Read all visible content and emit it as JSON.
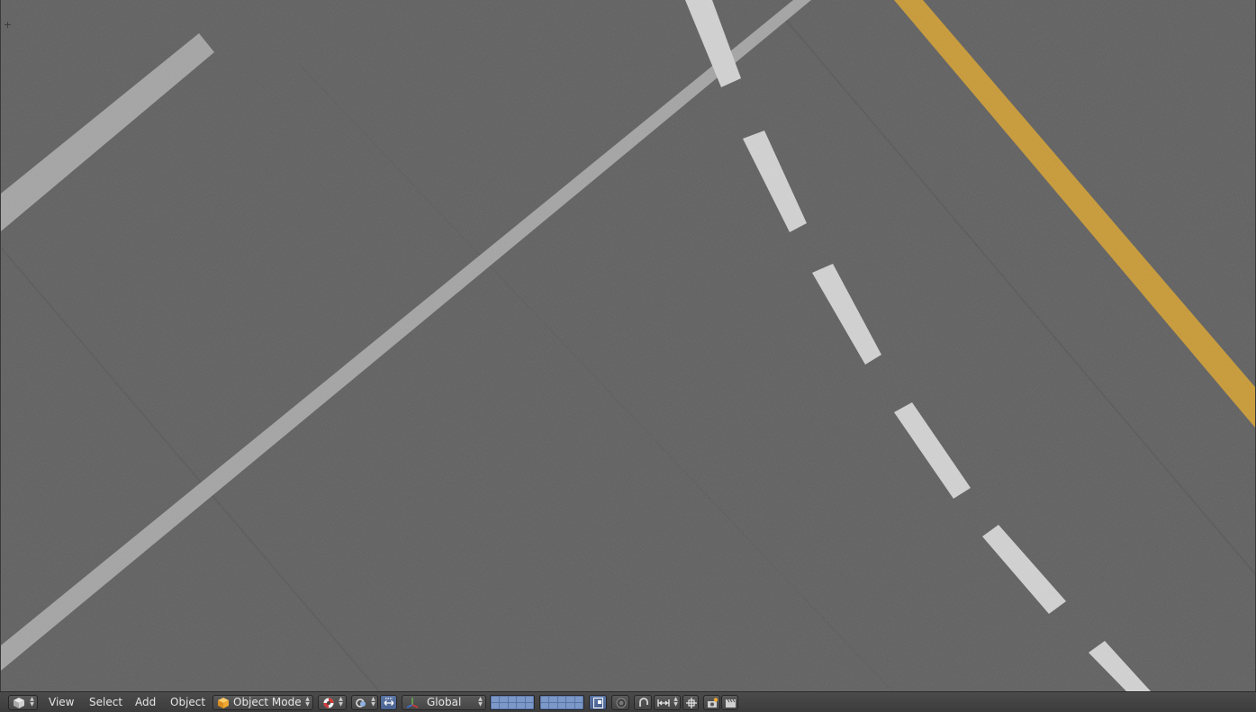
{
  "editor": {
    "type": "3D View",
    "menus": {
      "view": "View",
      "select": "Select",
      "add": "Add",
      "object": "Object"
    },
    "mode": "Object Mode",
    "transform_orientation": "Global"
  },
  "viewport": {
    "content": "top-down road texture",
    "asphalt_color": "#5f5f5f",
    "white_line_color": "#a4a4a4",
    "dash_color": "#d2d2d2",
    "yellow_line_color": "#c99a35"
  },
  "icons": {
    "editor_type": "cube-icon",
    "mode": "orange-cube-icon",
    "viewport_shading": "lifebuoy-icon",
    "pivot_point": "pivot-icon",
    "manipulator_toggle": "manipulator-icon",
    "manipulator_translate": "translate-arrows-icon",
    "proportional_edit": "circle-icon",
    "snap": "magnet-icon",
    "snap_element": "snap-element-icon",
    "snap_target": "snap-target-icon",
    "render": "camera-icon",
    "render_animation": "clapperboard-icon"
  }
}
